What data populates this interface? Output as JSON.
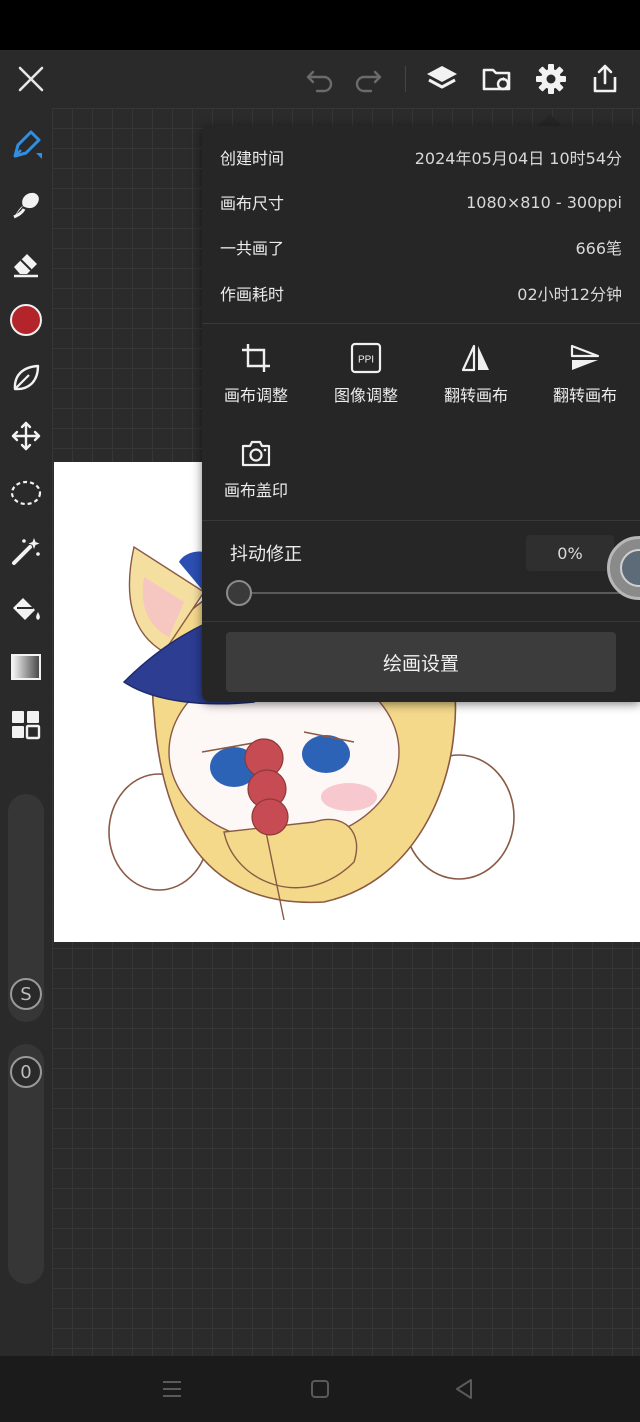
{
  "toolbar": {
    "close_icon": "close-icon",
    "undo_icon": "undo-icon",
    "redo_icon": "redo-icon",
    "layers_icon": "layers-icon",
    "folder_icon": "folder-sync-icon",
    "settings_icon": "gear-icon",
    "share_icon": "share-icon"
  },
  "tools": [
    "pen-icon",
    "smudge-icon",
    "eraser-icon",
    "color-swatch",
    "leaf-icon",
    "move-icon",
    "lasso-icon",
    "magic-wand-icon",
    "fill-bucket-icon",
    "gradient-icon",
    "grid-icon"
  ],
  "colors": {
    "accent": "#2f8fe5",
    "current_color": "#b3252b",
    "panel_bg": "#262626",
    "toolbar_bg": "#2a2a2a"
  },
  "brush_sliders": {
    "size_label": "S",
    "opacity_label": "0"
  },
  "canvas_info": {
    "rows": [
      {
        "label": "创建时间",
        "value": "2024年05月04日 10时54分"
      },
      {
        "label": "画布尺寸",
        "value": "1080×810 - 300ppi"
      },
      {
        "label": "一共画了",
        "value": "666笔"
      },
      {
        "label": "作画耗时",
        "value": "02小时12分钟"
      }
    ]
  },
  "actions": [
    {
      "label": "画布调整",
      "icon": "crop-icon"
    },
    {
      "label": "图像调整",
      "icon": "ppi-icon",
      "icon_text": "PPI"
    },
    {
      "label": "翻转画布",
      "icon": "flip-horizontal-icon"
    },
    {
      "label": "翻转画布",
      "icon": "flip-vertical-icon"
    },
    {
      "label": "画布盖印",
      "icon": "camera-icon"
    }
  ],
  "stabilizer": {
    "label": "抖动修正",
    "value": "0%",
    "level": 0
  },
  "paint_settings_label": "绘画设置",
  "nav": [
    "menu-icon",
    "home-icon",
    "back-icon"
  ]
}
